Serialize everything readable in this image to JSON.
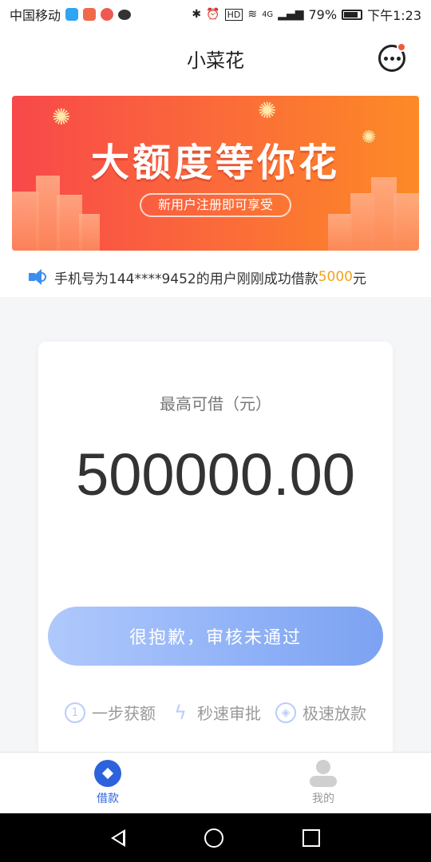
{
  "status_bar": {
    "carrier": "中国移动",
    "network": "4G",
    "battery": "79%",
    "time": "下午1:23"
  },
  "header": {
    "title": "小菜花"
  },
  "banner": {
    "headline": "大额度等你花",
    "subline": "新用户注册即可享受"
  },
  "marquee": {
    "prefix": "手机号为144****9452的用户刚刚成功借款",
    "amount": "5000",
    "suffix": "元"
  },
  "card": {
    "label": "最高可借（元）",
    "value": "500000.00",
    "button_label": "很抱歉，审核未通过",
    "features": [
      {
        "icon": "number-one-icon",
        "label": "一步获额"
      },
      {
        "icon": "lightning-icon",
        "label": "秒速审批"
      },
      {
        "icon": "coin-icon",
        "label": "极速放款"
      }
    ]
  },
  "tabbar": {
    "items": [
      {
        "label": "借款",
        "active": true
      },
      {
        "label": "我的",
        "active": false
      }
    ]
  },
  "colors": {
    "accent": "#2c63dc",
    "amount_highlight": "#f3a21a",
    "banner_start": "#f8484a",
    "banner_end": "#fc8a26"
  }
}
